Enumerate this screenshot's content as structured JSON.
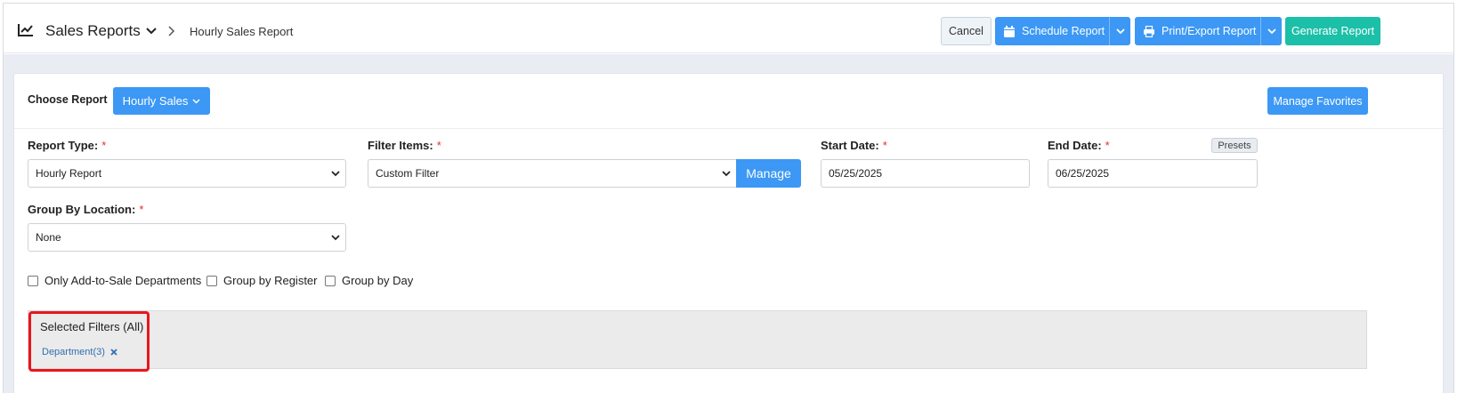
{
  "header": {
    "title": "Sales Reports",
    "breadcrumb": "Hourly Sales Report",
    "buttons": {
      "cancel": "Cancel",
      "schedule": "Schedule Report",
      "print_export": "Print/Export Report",
      "generate": "Generate Report"
    }
  },
  "report_chooser": {
    "label": "Choose Report",
    "selected": "Hourly Sales",
    "manage_favorites": "Manage Favorites"
  },
  "form": {
    "report_type": {
      "label": "Report Type:",
      "required": "*",
      "value": "Hourly Report"
    },
    "filter_items": {
      "label": "Filter Items:",
      "required": "*",
      "value": "Custom Filter",
      "manage_button": "Manage"
    },
    "start_date": {
      "label": "Start Date:",
      "required": "*",
      "value": "05/25/2025"
    },
    "end_date": {
      "label": "End Date:",
      "required": "*",
      "value": "06/25/2025",
      "presets_button": "Presets"
    },
    "group_by_location": {
      "label": "Group By Location:",
      "required": "*",
      "value": "None"
    }
  },
  "checkboxes": [
    {
      "label": "Only Add-to-Sale Departments",
      "checked": false
    },
    {
      "label": "Group by Register",
      "checked": false
    },
    {
      "label": "Group by Day",
      "checked": false
    }
  ],
  "selected_filters": {
    "title": "Selected Filters (All)",
    "chips": [
      {
        "label": "Department(3)"
      }
    ]
  },
  "colors": {
    "primary": "#3c98f4",
    "generate": "#1cbfa8",
    "highlight": "#e8161c",
    "required": "#e03030"
  }
}
